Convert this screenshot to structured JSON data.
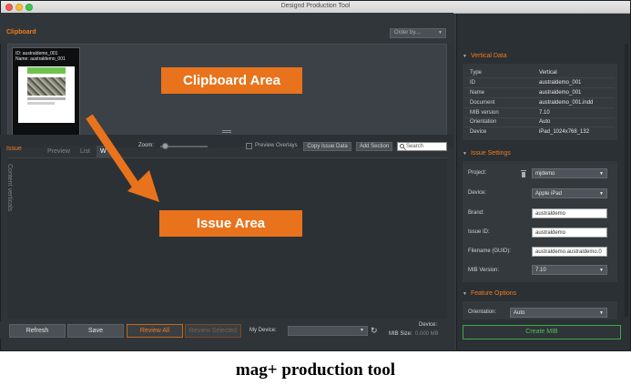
{
  "window": {
    "title": "Designd Production Tool"
  },
  "clipboard": {
    "title": "Clipboard",
    "order_by": "Order by....",
    "thumb_id": "ID: australdemo_001",
    "thumb_name": "Name: australdemo_001"
  },
  "issue": {
    "title": "Issue",
    "tabs": [
      "Preview",
      "List",
      "W"
    ],
    "zoom_label": "Zoom:",
    "zoom_level": 0.05,
    "preview_overlays": "Preview Overlays",
    "copy_issue_data": "Copy Issue Data",
    "add_section": "Add Section",
    "search_placeholder": "Search",
    "content_verticals": "Content verticals"
  },
  "bottom": {
    "refresh": "Refresh",
    "save": "Save",
    "review_all": "Review All",
    "review_selected": "Review Selected",
    "my_device": "My Device:",
    "device_label": "Device:",
    "mib_size_label": "MIB Size:",
    "mib_size_value": "0.000 MB"
  },
  "vertical_data": {
    "title": "Vertical Data",
    "rows": [
      {
        "key": "Type",
        "value": "Vertical"
      },
      {
        "key": "ID",
        "value": "australdemo_001"
      },
      {
        "key": "Name",
        "value": "australdemo_001"
      },
      {
        "key": "Document",
        "value": "australdemo_001.indd"
      },
      {
        "key": "MIB version",
        "value": "7.10"
      },
      {
        "key": "Orientation",
        "value": "Auto"
      },
      {
        "key": "Device",
        "value": "iPad_1024x768_132"
      }
    ]
  },
  "issue_settings": {
    "title": "Issue Settings",
    "project_label": "Project:",
    "project_value": "mjdemo",
    "device_label": "Device:",
    "device_value": "Apple iPad",
    "brand_label": "Brand:",
    "brand_value": "australdemo",
    "issue_id_label": "Issue ID:",
    "issue_id_value": "australdemo",
    "filename_label": "Filename (GUID):",
    "filename_value": "australdemo.australdemo.0",
    "mib_version_label": "MIB Version:",
    "mib_version_value": "7.10"
  },
  "feature_options": {
    "title": "Feature Options",
    "orientation_label": "Orientation:",
    "orientation_value": "Auto"
  },
  "create_mib": "Create MIB",
  "annotations": {
    "clipboard_area": "Clipboard Area",
    "issue_area": "Issue Area"
  },
  "caption": "mag+ production tool",
  "colors": {
    "accent_orange": "#f07c1f",
    "annotation_orange": "#e8731c",
    "create_green": "#4cc05a"
  }
}
